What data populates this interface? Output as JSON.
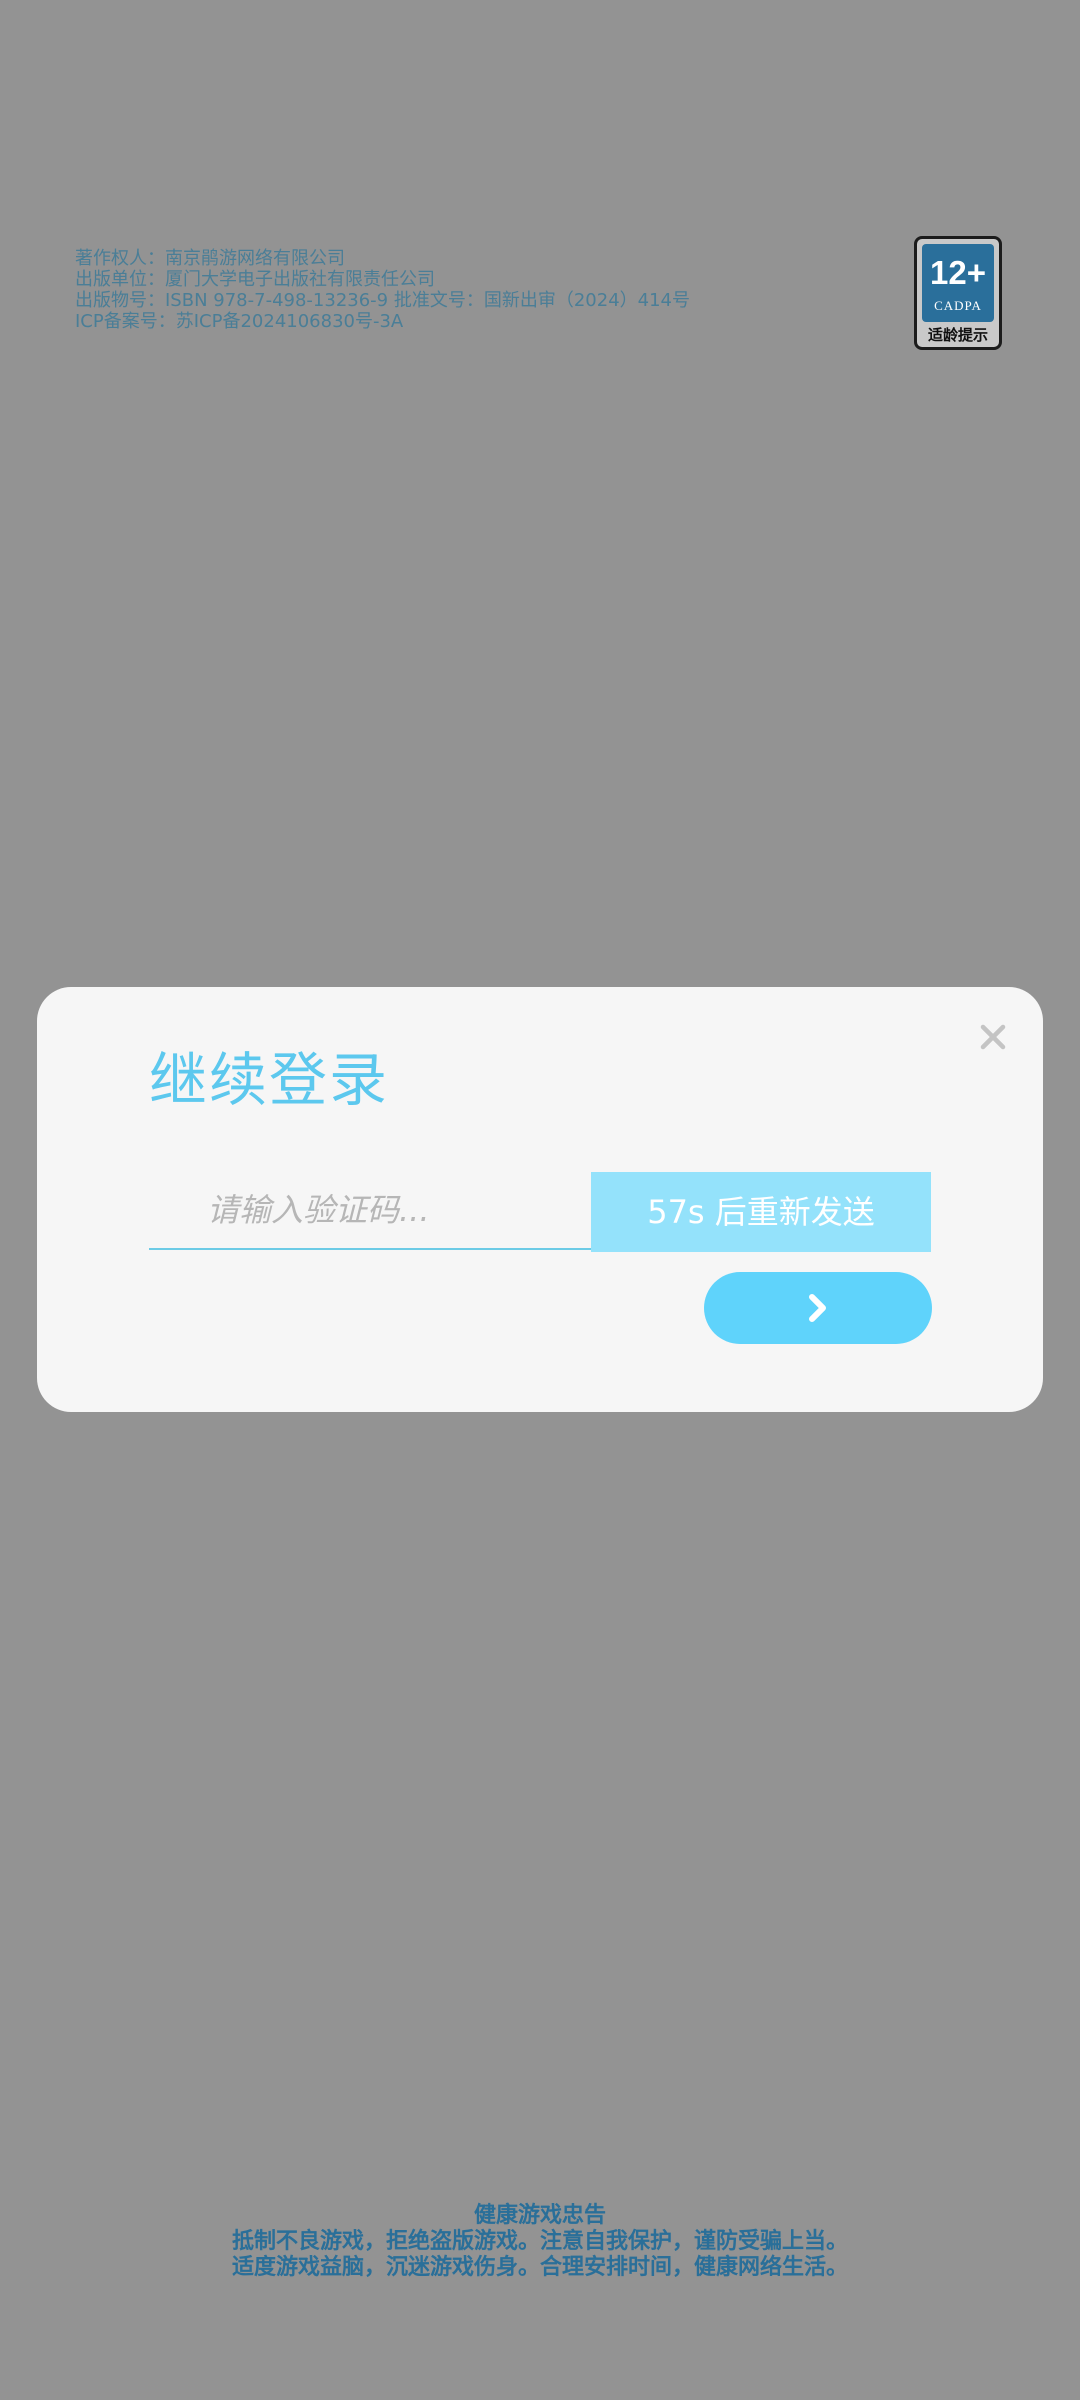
{
  "publisher_info": {
    "copyright_holder": "著作权人：南京鹃游网络有限公司",
    "publisher_unit": "出版单位：厦门大学电子出版社有限责任公司",
    "publication_number": "出版物号：ISBN 978-7-498-13236-9 批准文号：国新出审（2024）414号",
    "icp_number": "ICP备案号：苏ICP备2024106830号-3A"
  },
  "age_rating": {
    "age": "12+",
    "org": "CADPA",
    "label": "适龄提示"
  },
  "dialog": {
    "title": "继续登录",
    "code_placeholder": "请输入验证码...",
    "code_value": "",
    "resend_label": "57s 后重新发送",
    "close_icon": "close-icon",
    "next_icon": "chevron-right-icon"
  },
  "health_advisory": {
    "title": "健康游戏忠告",
    "line1": "抵制不良游戏，拒绝盗版游戏。注意自我保护，谨防受骗上当。",
    "line2": "适度游戏益脑，沉迷游戏伤身。合理安排时间，健康网络生活。"
  },
  "colors": {
    "overlay_background": "#939393",
    "accent": "#5cc8ee",
    "resend_button": "#94e2fb",
    "next_button": "#5fd3fb",
    "dialog_background": "#f6f6f6"
  }
}
